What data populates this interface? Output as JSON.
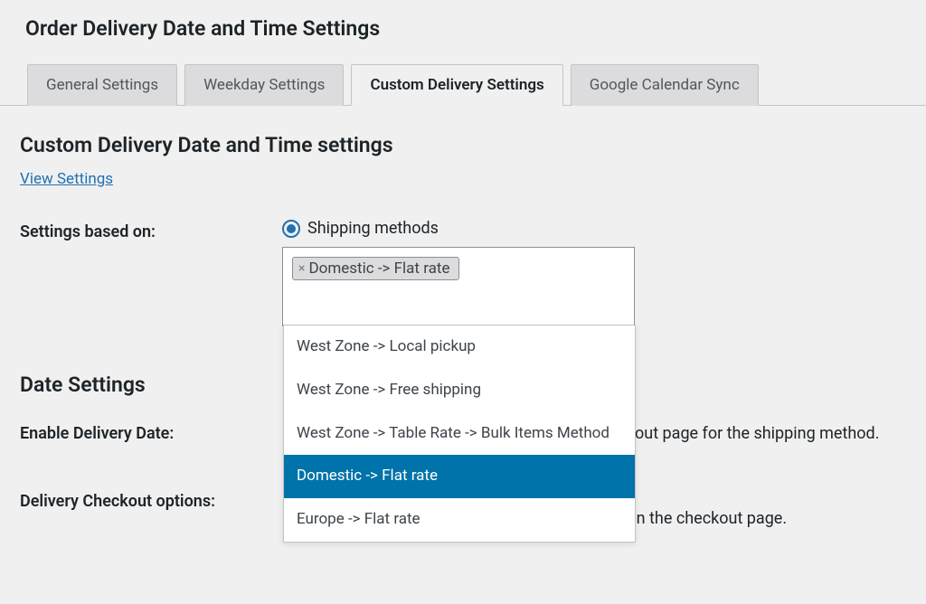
{
  "pageTitle": "Order Delivery Date and Time Settings",
  "tabs": [
    {
      "label": "General Settings"
    },
    {
      "label": "Weekday Settings"
    },
    {
      "label": "Custom Delivery Settings"
    },
    {
      "label": "Google Calendar Sync"
    }
  ],
  "sectionTitle": "Custom Delivery Date and Time settings",
  "viewLink": "View Settings",
  "settingsBasedOn": {
    "label": "Settings based on:",
    "radioLabel": "Shipping methods",
    "selectedChip": "Domestic -> Flat rate",
    "options": [
      "West Zone -> Local pickup",
      "West Zone -> Free shipping",
      "West Zone -> Table Rate -> Bulk Items Method",
      "Domestic -> Flat rate",
      "Europe -> Flat rate"
    ]
  },
  "dateSettings": {
    "heading": "Date Settings",
    "enableLabel": "Enable Delivery Date:",
    "enableDescTail": "out page for the shipping method.",
    "checkoutLabel": "Delivery Checkout options:",
    "checkoutDesc": "Choose the delivery date option to be displayed on the checkout page."
  }
}
